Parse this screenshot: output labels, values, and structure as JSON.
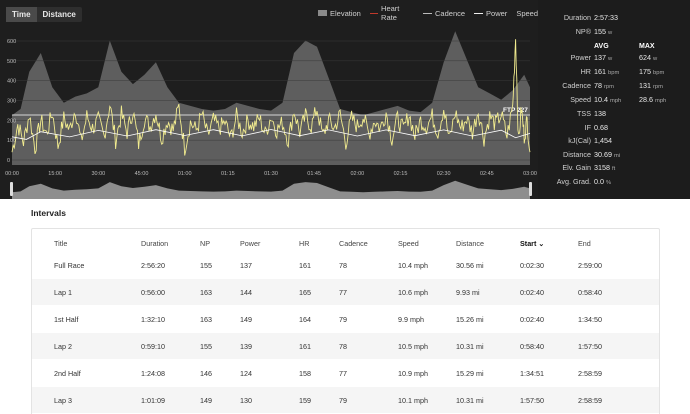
{
  "toolbar": {
    "tabs": [
      {
        "label": "Time",
        "active": true
      },
      {
        "label": "Distance",
        "active": false
      }
    ]
  },
  "legend": {
    "items": [
      {
        "label": "Elevation",
        "kind": "box",
        "color": "#8a8a8a"
      },
      {
        "label": "Heart Rate",
        "kind": "line",
        "color": "#c0392b"
      },
      {
        "label": "Cadence",
        "kind": "line",
        "color": "#bbbbbb"
      },
      {
        "label": "Power",
        "kind": "line",
        "color": "#eeeeee"
      },
      {
        "label": "Speed",
        "kind": "text",
        "color": "#cccccc"
      }
    ]
  },
  "chart_data": {
    "type": "line",
    "y_ticks": [
      "600",
      "500",
      "400",
      "300",
      "200",
      "100",
      "0"
    ],
    "x_ticks": [
      "00:00",
      "15:00",
      "30:00",
      "45:00",
      "01:00",
      "01:15",
      "01:30",
      "01:45",
      "02:00",
      "02:15",
      "02:30",
      "02:45",
      "03:00"
    ],
    "ftp_label": "FTP 227",
    "ftp_value": 227,
    "ylim": [
      0,
      600
    ],
    "xlim_minutes": [
      0,
      180
    ],
    "colors": {
      "power": "#f2ec8f",
      "heart_rate": "#ffffff",
      "elevation": "#6a6a6a",
      "mini_elevation": "#8e8e8e"
    },
    "elevation_profile_m": [
      [
        0,
        160
      ],
      [
        3,
        180
      ],
      [
        6,
        300
      ],
      [
        10,
        360
      ],
      [
        14,
        250
      ],
      [
        18,
        200
      ],
      [
        22,
        220
      ],
      [
        26,
        230
      ],
      [
        30,
        250
      ],
      [
        34,
        400
      ],
      [
        38,
        300
      ],
      [
        42,
        260
      ],
      [
        46,
        290
      ],
      [
        50,
        330
      ],
      [
        54,
        250
      ],
      [
        58,
        200
      ],
      [
        62,
        190
      ],
      [
        66,
        180
      ],
      [
        70,
        175
      ],
      [
        74,
        180
      ],
      [
        78,
        200
      ],
      [
        82,
        190
      ],
      [
        86,
        180
      ],
      [
        90,
        175
      ],
      [
        94,
        200
      ],
      [
        98,
        360
      ],
      [
        102,
        400
      ],
      [
        106,
        380
      ],
      [
        110,
        280
      ],
      [
        114,
        180
      ],
      [
        118,
        170
      ],
      [
        122,
        160
      ],
      [
        126,
        170
      ],
      [
        130,
        180
      ],
      [
        134,
        190
      ],
      [
        138,
        175
      ],
      [
        142,
        170
      ],
      [
        146,
        200
      ],
      [
        150,
        330
      ],
      [
        154,
        430
      ],
      [
        158,
        340
      ],
      [
        162,
        250
      ],
      [
        166,
        230
      ],
      [
        170,
        210
      ],
      [
        174,
        240
      ],
      [
        178,
        290
      ],
      [
        180,
        250
      ]
    ],
    "heart_rate_bpm": [
      [
        0,
        120
      ],
      [
        5,
        140
      ],
      [
        10,
        150
      ],
      [
        20,
        155
      ],
      [
        30,
        158
      ],
      [
        40,
        160
      ],
      [
        50,
        162
      ],
      [
        60,
        163
      ],
      [
        70,
        162
      ],
      [
        80,
        161
      ],
      [
        90,
        163
      ],
      [
        100,
        162
      ],
      [
        110,
        161
      ],
      [
        120,
        160
      ],
      [
        130,
        161
      ],
      [
        140,
        162
      ],
      [
        150,
        161
      ],
      [
        160,
        160
      ],
      [
        170,
        159
      ],
      [
        175,
        150
      ],
      [
        180,
        140
      ]
    ],
    "power_w": [
      [
        0,
        40
      ],
      [
        2,
        180
      ],
      [
        4,
        90
      ],
      [
        6,
        230
      ],
      [
        8,
        60
      ],
      [
        10,
        200
      ],
      [
        12,
        130
      ],
      [
        14,
        240
      ],
      [
        16,
        70
      ],
      [
        18,
        210
      ],
      [
        20,
        150
      ],
      [
        22,
        260
      ],
      [
        24,
        90
      ],
      [
        26,
        220
      ],
      [
        28,
        160
      ],
      [
        30,
        200
      ],
      [
        32,
        120
      ],
      [
        34,
        280
      ],
      [
        36,
        100
      ],
      [
        38,
        230
      ],
      [
        40,
        140
      ],
      [
        42,
        250
      ],
      [
        44,
        80
      ],
      [
        46,
        210
      ],
      [
        48,
        170
      ],
      [
        50,
        240
      ],
      [
        52,
        110
      ],
      [
        54,
        200
      ],
      [
        56,
        150
      ],
      [
        58,
        270
      ],
      [
        60,
        60
      ],
      [
        62,
        190
      ],
      [
        64,
        150
      ],
      [
        66,
        230
      ],
      [
        68,
        120
      ],
      [
        70,
        200
      ],
      [
        72,
        160
      ],
      [
        74,
        190
      ],
      [
        76,
        110
      ],
      [
        78,
        220
      ],
      [
        80,
        140
      ],
      [
        82,
        200
      ],
      [
        84,
        170
      ],
      [
        86,
        210
      ],
      [
        88,
        130
      ],
      [
        90,
        220
      ],
      [
        92,
        150
      ],
      [
        94,
        190
      ],
      [
        96,
        100
      ],
      [
        98,
        250
      ],
      [
        100,
        140
      ],
      [
        102,
        220
      ],
      [
        104,
        170
      ],
      [
        106,
        260
      ],
      [
        108,
        120
      ],
      [
        110,
        200
      ],
      [
        112,
        160
      ],
      [
        114,
        230
      ],
      [
        116,
        90
      ],
      [
        118,
        210
      ],
      [
        120,
        170
      ],
      [
        122,
        220
      ],
      [
        124,
        130
      ],
      [
        126,
        200
      ],
      [
        128,
        160
      ],
      [
        130,
        240
      ],
      [
        132,
        110
      ],
      [
        134,
        210
      ],
      [
        136,
        150
      ],
      [
        138,
        230
      ],
      [
        140,
        120
      ],
      [
        142,
        200
      ],
      [
        144,
        170
      ],
      [
        146,
        220
      ],
      [
        148,
        140
      ],
      [
        150,
        260
      ],
      [
        152,
        100
      ],
      [
        154,
        240
      ],
      [
        156,
        160
      ],
      [
        158,
        210
      ],
      [
        160,
        140
      ],
      [
        162,
        250
      ],
      [
        164,
        110
      ],
      [
        166,
        220
      ],
      [
        168,
        180
      ],
      [
        170,
        230
      ],
      [
        172,
        120
      ],
      [
        174,
        270
      ],
      [
        175,
        620
      ],
      [
        176,
        90
      ],
      [
        177,
        260
      ],
      [
        178,
        120
      ],
      [
        179,
        200
      ],
      [
        180,
        40
      ]
    ]
  },
  "stats": {
    "duration_label": "Duration",
    "duration_value": "2:57:33",
    "np_label": "NP®",
    "np_value": "155",
    "np_unit": "w",
    "avg_header": "AVG",
    "max_header": "MAX",
    "rows": [
      {
        "label": "Power",
        "avg": "137",
        "avg_unit": "w",
        "max": "624",
        "max_unit": "w"
      },
      {
        "label": "HR",
        "avg": "161",
        "avg_unit": "bpm",
        "max": "175",
        "max_unit": "bpm"
      },
      {
        "label": "Cadence",
        "avg": "78",
        "avg_unit": "rpm",
        "max": "131",
        "max_unit": "rpm"
      },
      {
        "label": "Speed",
        "avg": "10.4",
        "avg_unit": "mph",
        "max": "28.6",
        "max_unit": "mph"
      }
    ],
    "singles": [
      {
        "label": "TSS",
        "value": "138",
        "unit": ""
      },
      {
        "label": "IF",
        "value": "0.68",
        "unit": ""
      },
      {
        "label": "kJ(Cal)",
        "value": "1,454",
        "unit": ""
      },
      {
        "label": "Distance",
        "value": "30.69",
        "unit": "mi"
      },
      {
        "label": "Elv. Gain",
        "value": "3158",
        "unit": "ft"
      },
      {
        "label": "Avg. Grad.",
        "value": "0.0",
        "unit": "%"
      }
    ]
  },
  "intervals": {
    "title": "Intervals",
    "columns": [
      "Title",
      "Duration",
      "NP",
      "Power",
      "HR",
      "Cadence",
      "Speed",
      "Distance",
      "Start",
      "End"
    ],
    "sorted_column": "Start",
    "sort_indicator": "⌄",
    "rows": [
      [
        "Full Race",
        "2:56:20",
        "155",
        "137",
        "161",
        "78",
        "10.4 mph",
        "30.56 mi",
        "0:02:30",
        "2:59:00"
      ],
      [
        "Lap 1",
        "0:56:00",
        "163",
        "144",
        "165",
        "77",
        "10.6 mph",
        "9.93 mi",
        "0:02:40",
        "0:58:40"
      ],
      [
        "1st Half",
        "1:32:10",
        "163",
        "149",
        "164",
        "79",
        "9.9 mph",
        "15.26 mi",
        "0:02:40",
        "1:34:50"
      ],
      [
        "Lap 2",
        "0:59:10",
        "155",
        "139",
        "161",
        "78",
        "10.5 mph",
        "10.31 mi",
        "0:58:40",
        "1:57:50"
      ],
      [
        "2nd Half",
        "1:24:08",
        "146",
        "124",
        "158",
        "77",
        "10.9 mph",
        "15.29 mi",
        "1:34:51",
        "2:58:59"
      ],
      [
        "Lap 3",
        "1:01:09",
        "149",
        "130",
        "159",
        "79",
        "10.1 mph",
        "10.31 mi",
        "1:57:50",
        "2:58:59"
      ]
    ]
  }
}
